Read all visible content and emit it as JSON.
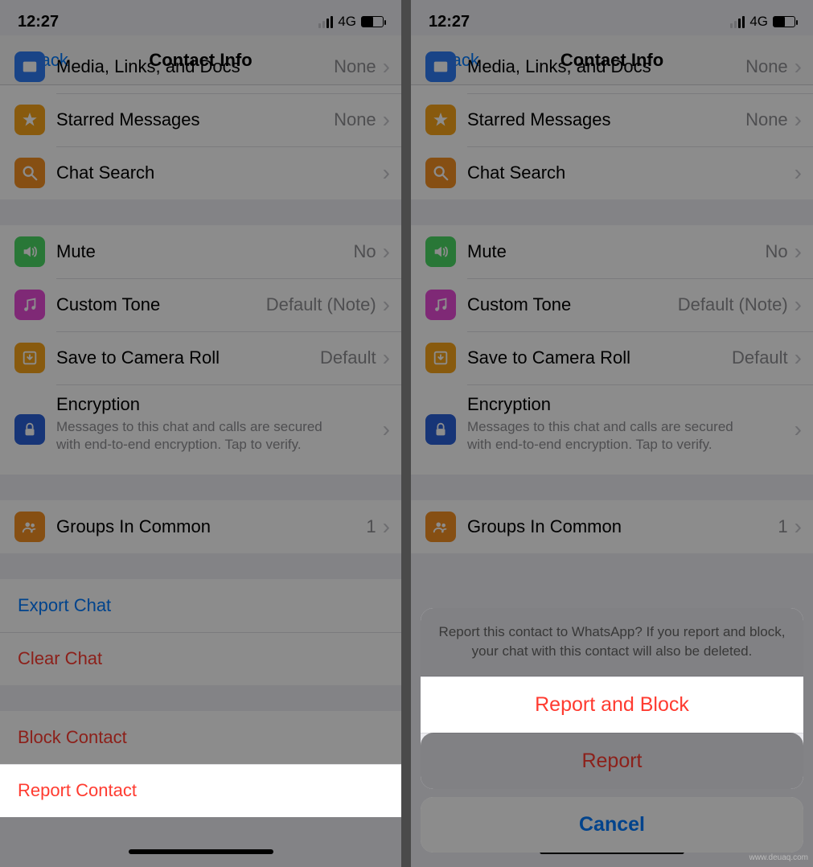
{
  "status": {
    "time": "12:27",
    "network": "4G"
  },
  "nav": {
    "back": "Back",
    "title": "Contact Info"
  },
  "rows": {
    "media": {
      "label": "Media, Links, and Docs",
      "value": "None"
    },
    "starred": {
      "label": "Starred Messages",
      "value": "None"
    },
    "search": {
      "label": "Chat Search"
    },
    "mute": {
      "label": "Mute",
      "value": "No"
    },
    "tone": {
      "label": "Custom Tone",
      "value": "Default (Note)"
    },
    "camera": {
      "label": "Save to Camera Roll",
      "value": "Default"
    },
    "encryption": {
      "label": "Encryption",
      "sub": "Messages to this chat and calls are secured with end-to-end encryption. Tap to verify."
    },
    "groups": {
      "label": "Groups In Common",
      "value": "1"
    }
  },
  "actions": {
    "export": "Export Chat",
    "clear": "Clear Chat",
    "block": "Block Contact",
    "report": "Report Contact"
  },
  "sheet": {
    "message": "Report this contact to WhatsApp? If you report and block, your chat with this contact will also be deleted.",
    "reportBlock": "Report and Block",
    "report": "Report",
    "cancel": "Cancel"
  },
  "colors": {
    "blue": "#2f7cf6",
    "yellow": "#f8a51b",
    "orange": "#f59123",
    "green": "#4cd964",
    "magenta": "#e84bd7",
    "darkblue": "#2b62d9"
  },
  "watermark": "www.deuaq.com"
}
